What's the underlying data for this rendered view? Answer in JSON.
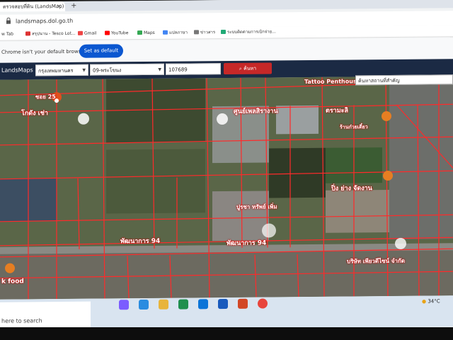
{
  "browser": {
    "tab_title": "ตรวจสอบที่ดิน (LandsMap)",
    "tab_close": "×",
    "new_tab": "+",
    "url": "landsmaps.dol.go.th",
    "bookmarks": [
      "w Tab",
      "สรุปนาน - Tesco Lot...",
      "Gmail",
      "YouTube",
      "Maps",
      "แปลภาษา",
      "ข่าวสาร",
      "ระบบติดตามการเบิกจ่าย..."
    ],
    "default_message": "Chrome isn't your default browser",
    "set_default": "Set as default"
  },
  "app": {
    "logo": "LandsMaps",
    "province": "กรุงเทพมหานคร",
    "district": "09-พระโขนง",
    "parcel_number": "107689",
    "search_button": "ค้นหา",
    "place_search": "ค้นหาสถานที่สำคัญ"
  },
  "map": {
    "labels": [
      "ซอย 25",
      "โกดัง เช่า",
      "ศูนย์เพลสิรางาน",
      "ตรามะลิ",
      "ปิ่ง ย่าง จัดงาน",
      "Tattoo Penthouse",
      "พัฒนาการ 94",
      "พัฒนาการ 94",
      "k food",
      "ร้านก๋วยเตี๋ยว",
      "ปูรชา ทรัพย์ เพิ่ม",
      "บริษัท เพียวดีไซน์ จำกัด"
    ]
  },
  "taskbar": {
    "search_text": "here to search",
    "temperature": "34°C"
  },
  "colors": {
    "parcel_line": "#ff2a2a",
    "header": "#1b2a44",
    "search_button": "#c62828",
    "set_default": "#0b57d0"
  }
}
